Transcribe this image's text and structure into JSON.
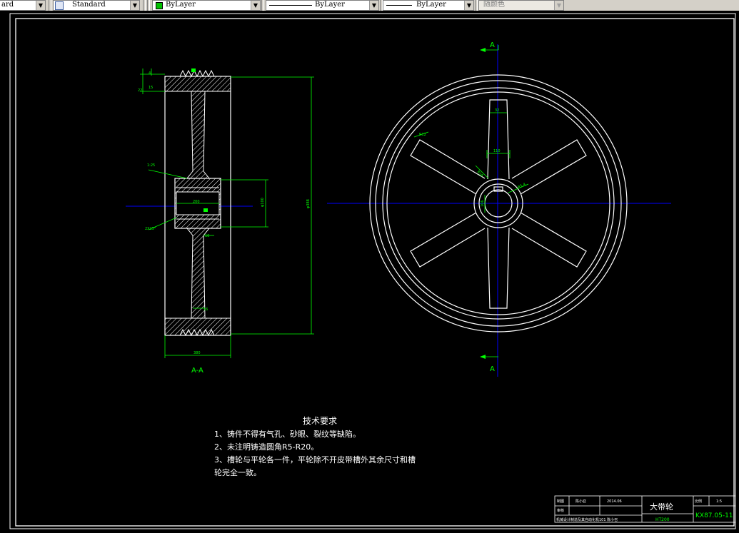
{
  "toolbar": {
    "text_style": "ard",
    "dim_style": "Standard",
    "layer_color": "ByLayer",
    "linetype": "ByLayer",
    "lineweight": "ByLayer",
    "plot_style": "随颜色",
    "layer_color_swatch": "#00c000"
  },
  "drawing": {
    "section_view_label": "A-A",
    "section_marker_top": "A",
    "section_marker_bottom": "A",
    "dims_section": {
      "d1": "4",
      "d2": "22",
      "d3": "15",
      "taper": "1:25",
      "bore_len": "200",
      "bore_dia": "φ100",
      "chamfer": "2X15°",
      "web": "16",
      "web2": "16",
      "outer_dia": "φ388",
      "width": "380"
    },
    "dims_front": {
      "spoke_top": "32",
      "spoke_mid": "110",
      "r1": "R12",
      "r2": "R16",
      "hub_r": "R5.4",
      "key": "106"
    },
    "colors": {
      "geometry": "#ffffff",
      "dimension": "#00ff00",
      "centerline": "#0000ff"
    }
  },
  "notes": {
    "heading": "技术要求",
    "line1": "1、铸件不得有气孔、砂眼、裂纹等缺陷。",
    "line2": "2、未注明铸造圆角R5-R20。",
    "line3": "3、槽轮与平轮各一件，平轮除不开皮带槽外其余尺寸和槽",
    "line4": "轮完全一致。"
  },
  "title_block": {
    "draw_label": "制图",
    "drawer": "陈小召",
    "date": "2014.06",
    "review_label": "审核",
    "part_name": "大带轮",
    "scale_label": "比例",
    "scale": "1:5",
    "school": "机械设计制造及其自动化机101 陈小召",
    "material": "HT200",
    "drawing_no": "KX87.05-11"
  }
}
